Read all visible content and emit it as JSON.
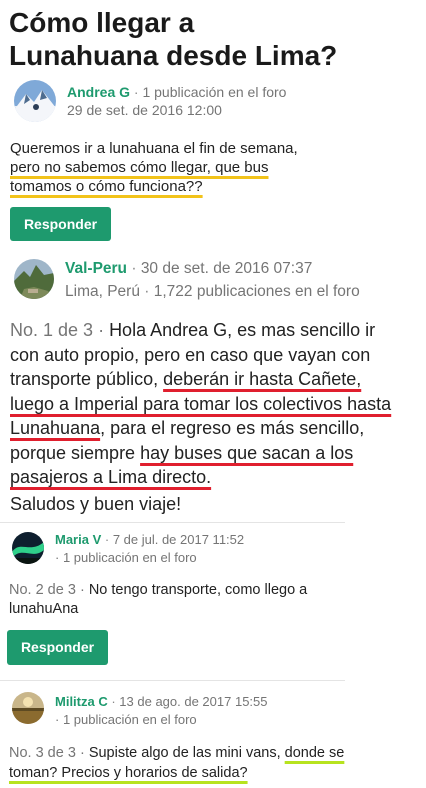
{
  "thread": {
    "title": "Cómo llegar a Lunahuana desde Lima?"
  },
  "posts": [
    {
      "author": "Andrea G",
      "sep": " · ",
      "count": "1 publicación en el foro",
      "date": "29 de set. de 2016 12:00",
      "text_before": "Queremos ir a lunahuana el fin de semana,",
      "text_highlight": "pero no sabemos cómo llegar, que bus tomamos o cómo funciona??",
      "reply_label": "Responder"
    },
    {
      "author": "Val-Peru",
      "sep": " · ",
      "date": "30 de set. de 2016 07:37",
      "location": "Lima, Perú",
      "count": "1,722 publicaciones en el foro",
      "number": "No. 1 de 3",
      "dot": " · ",
      "text_a": "Hola Andrea G, es mas sencillo ir con auto propio, pero en caso que vayan con transporte público, ",
      "text_hl1": "deberán ir hasta Cañete, luego a Imperial para tomar los colectivos hasta Lunahuana",
      "text_b": ", para el regreso es más sencillo, porque siempre ",
      "text_hl2": "hay buses que sacan a los pasajeros a Lima directo.",
      "signoff": "Saludos y buen viaje!"
    },
    {
      "author": "Maria V",
      "sep": " · ",
      "date": "7 de jul. de 2017 11:52",
      "count": "1 publicación en el foro",
      "number": "No. 2 de 3",
      "dot": " · ",
      "text": "No tengo transporte, como llego a lunahuAna",
      "reply_label": "Responder"
    },
    {
      "author": "Militza C",
      "sep": " · ",
      "date": "13 de ago. de 2017 15:55",
      "count": "1 publicación en el foro",
      "number": "No. 3 de 3",
      "dot": " · ",
      "text_before": "Supiste algo de las mini vans,",
      "text_highlight": "donde se toman? Precios y horarios de salida?"
    }
  ],
  "colors": {
    "accent": "#1e9a6e",
    "highlight_yellow": "#f2c31a",
    "highlight_red": "#e01f2e",
    "highlight_green": "#b7e31f"
  },
  "icons": {
    "avatar_andrea": "mountain-snow-avatar",
    "avatar_val": "machu-picchu-avatar",
    "avatar_maria": "aurora-avatar",
    "avatar_militza": "field-avatar"
  }
}
